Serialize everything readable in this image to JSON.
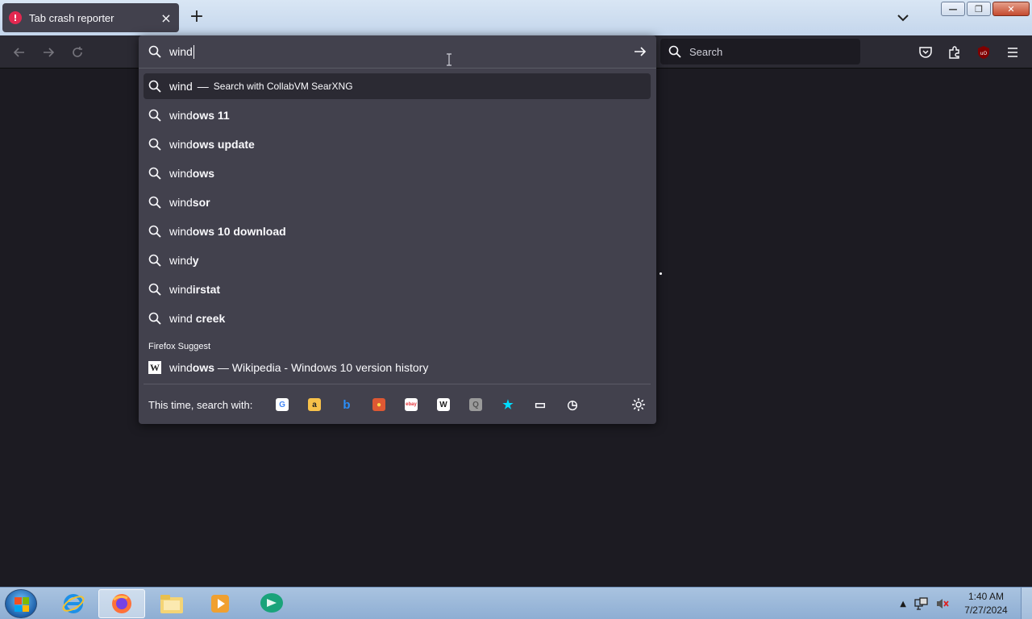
{
  "window": {
    "tab_title": "Tab crash reporter",
    "tab_close": "×",
    "newtab": "+",
    "win_min": "—",
    "win_max": "❐",
    "win_close": "✕"
  },
  "toolbar": {
    "search_placeholder": "Search"
  },
  "urlbar": {
    "typed": "wind",
    "heuristic": {
      "text": "wind",
      "sep": "—",
      "action": "Search with CollabVM SearXNG"
    },
    "suggestions": [
      {
        "prefix": "wind",
        "bold": "ows 11"
      },
      {
        "prefix": "wind",
        "bold": "ows update"
      },
      {
        "prefix": "wind",
        "bold": "ows"
      },
      {
        "prefix": "wind",
        "bold": "sor"
      },
      {
        "prefix": "wind",
        "bold": "ows 10 download"
      },
      {
        "prefix": "wind",
        "bold": "y"
      },
      {
        "prefix": "wind",
        "bold": "irstat"
      },
      {
        "prefix": "wind ",
        "bold": "creek"
      }
    ],
    "group_label": "Firefox Suggest",
    "suggest": {
      "prefix": "wind",
      "bold": "ows",
      "rest": " — Wikipedia - Windows 10 version history"
    },
    "oneoff_label": "This time, search with:",
    "engines": [
      {
        "name": "google-engine",
        "glyph": "G",
        "bg": "#ffffff",
        "fg": "#4285f4"
      },
      {
        "name": "amazon-engine",
        "glyph": "a",
        "bg": "#f7c14a",
        "fg": "#222222"
      },
      {
        "name": "bing-engine",
        "glyph": "b",
        "bg": "transparent",
        "fg": "#2a8df7"
      },
      {
        "name": "duckduckgo-engine",
        "glyph": "●",
        "bg": "#de5833",
        "fg": "#ffd84d"
      },
      {
        "name": "ebay-engine",
        "glyph": "ebay",
        "bg": "#ffffff",
        "fg": "#e53238"
      },
      {
        "name": "wikipedia-engine",
        "glyph": "W",
        "bg": "#ffffff",
        "fg": "#222222"
      },
      {
        "name": "searxng-engine",
        "glyph": "Q",
        "bg": "#9a9a9a",
        "fg": "#555555"
      },
      {
        "name": "bookmarks-engine",
        "glyph": "★",
        "bg": "transparent",
        "fg": "#00ddff"
      },
      {
        "name": "tabs-engine",
        "glyph": "▭",
        "bg": "transparent",
        "fg": "#fbfbfe"
      },
      {
        "name": "history-engine",
        "glyph": "◷",
        "bg": "transparent",
        "fg": "#fbfbfe"
      }
    ]
  },
  "taskbar": {
    "time": "1:40 AM",
    "date": "7/27/2024"
  }
}
